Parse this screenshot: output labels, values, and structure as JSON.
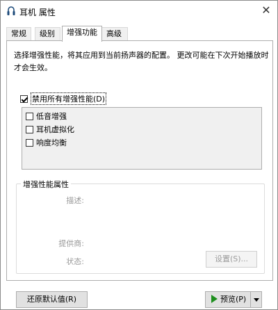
{
  "window": {
    "title": "耳机 属性",
    "close_glyph": "✕"
  },
  "tabs": [
    {
      "label": "常规",
      "active": false
    },
    {
      "label": "级别",
      "active": false
    },
    {
      "label": "增强功能",
      "active": true
    },
    {
      "label": "高级",
      "active": false
    }
  ],
  "enhancements": {
    "description": "选择增强性能，将其应用到当前扬声器的配置。 更改可能在下次开始播放时才会生效。",
    "disable_all": {
      "label": "禁用所有增强性能(D)",
      "checked": true
    },
    "items": [
      {
        "label": "低音增强",
        "checked": false
      },
      {
        "label": "耳机虚拟化",
        "checked": false
      },
      {
        "label": "响度均衡",
        "checked": false
      }
    ]
  },
  "properties": {
    "group_title": "增强性能属性",
    "description_label": "描述:",
    "provider_label": "提供商:",
    "status_label": "状态:",
    "settings_button": "设置(S)..."
  },
  "footer": {
    "restore_defaults_button": "还原默认值(R)",
    "preview_button": "预览(P)"
  },
  "colors": {
    "accent_green": "#1e8f1e",
    "disabled_text": "#9a9a9a",
    "list_background": "#f0f0f0"
  }
}
